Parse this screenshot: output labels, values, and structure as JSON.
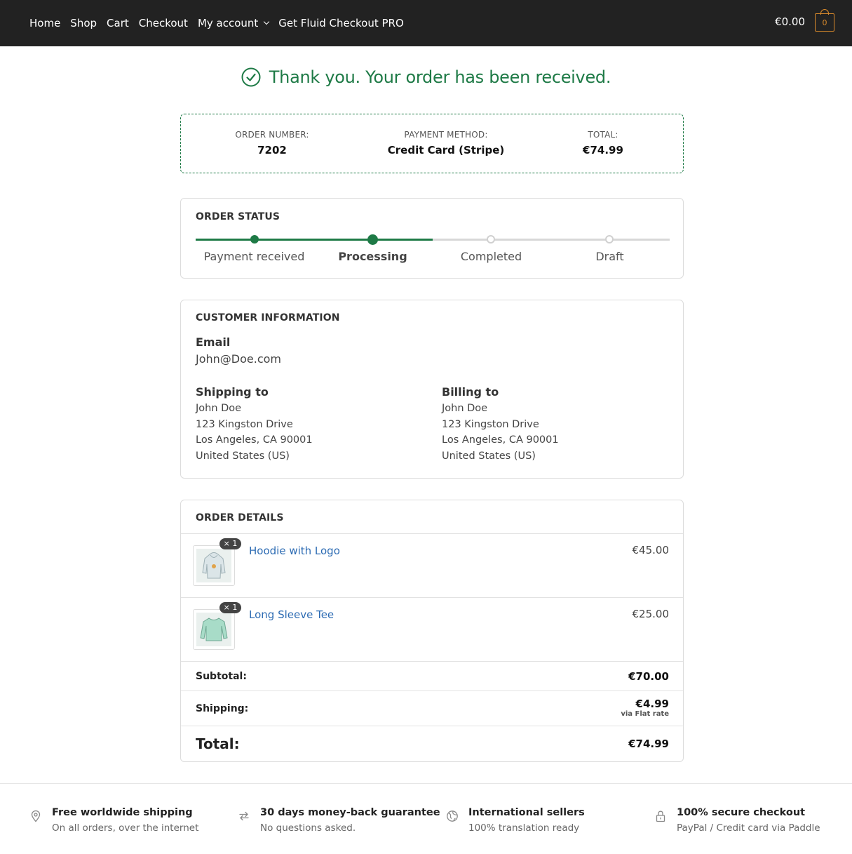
{
  "nav": {
    "items": [
      {
        "label": "Home"
      },
      {
        "label": "Shop"
      },
      {
        "label": "Cart"
      },
      {
        "label": "Checkout"
      },
      {
        "label": "My account",
        "has_dropdown": true
      },
      {
        "label": "Get Fluid Checkout PRO"
      }
    ],
    "cart_total": "€0.00",
    "cart_count": "0"
  },
  "thanks": {
    "message": "Thank you. Your order has been received."
  },
  "overview": {
    "order_number_label": "ORDER NUMBER:",
    "order_number": "7202",
    "payment_method_label": "PAYMENT METHOD:",
    "payment_method": "Credit Card (Stripe)",
    "total_label": "TOTAL:",
    "total": "€74.99"
  },
  "order_status": {
    "title": "ORDER STATUS",
    "steps": [
      {
        "label": "Payment received",
        "state": "done"
      },
      {
        "label": "Processing",
        "state": "current"
      },
      {
        "label": "Completed",
        "state": "todo"
      },
      {
        "label": "Draft",
        "state": "todo"
      }
    ]
  },
  "customer": {
    "title": "CUSTOMER INFORMATION",
    "email_heading": "Email",
    "email": "John@Doe.com",
    "shipping_heading": "Shipping to",
    "shipping": {
      "name": "John Doe",
      "street": "123 Kingston Drive",
      "city": "Los Angeles, CA 90001",
      "country": "United States (US)"
    },
    "billing_heading": "Billing to",
    "billing": {
      "name": "John Doe",
      "street": "123 Kingston Drive",
      "city": "Los Angeles, CA 90001",
      "country": "United States (US)"
    }
  },
  "order_details": {
    "title": "ORDER DETAILS",
    "items": [
      {
        "name": "Hoodie with Logo",
        "qty": "× 1",
        "price": "€45.00",
        "icon": "hoodie-image"
      },
      {
        "name": "Long Sleeve Tee",
        "qty": "× 1",
        "price": "€25.00",
        "icon": "long-sleeve-tee-image"
      }
    ],
    "subtotal_label": "Subtotal:",
    "subtotal": "€70.00",
    "shipping_label": "Shipping:",
    "shipping": "€4.99",
    "shipping_method": "via Flat rate",
    "total_label": "Total:",
    "total": "€74.99"
  },
  "footer": {
    "features": [
      {
        "icon": "location-pin-icon",
        "title": "Free worldwide shipping",
        "subtitle": "On all orders, over the internet"
      },
      {
        "icon": "exchange-arrows-icon",
        "title": "30 days money-back guarantee",
        "subtitle": "No questions asked."
      },
      {
        "icon": "globe-icon",
        "title": "International sellers",
        "subtitle": "100% translation ready"
      },
      {
        "icon": "lock-icon",
        "title": "100% secure checkout",
        "subtitle": "PayPal / Credit card via Paddle"
      }
    ]
  },
  "colors": {
    "topbar": "#222222",
    "accent_green": "#1e7a46",
    "link_blue": "#2c6bb3",
    "cart_orange": "#d98a2b"
  }
}
